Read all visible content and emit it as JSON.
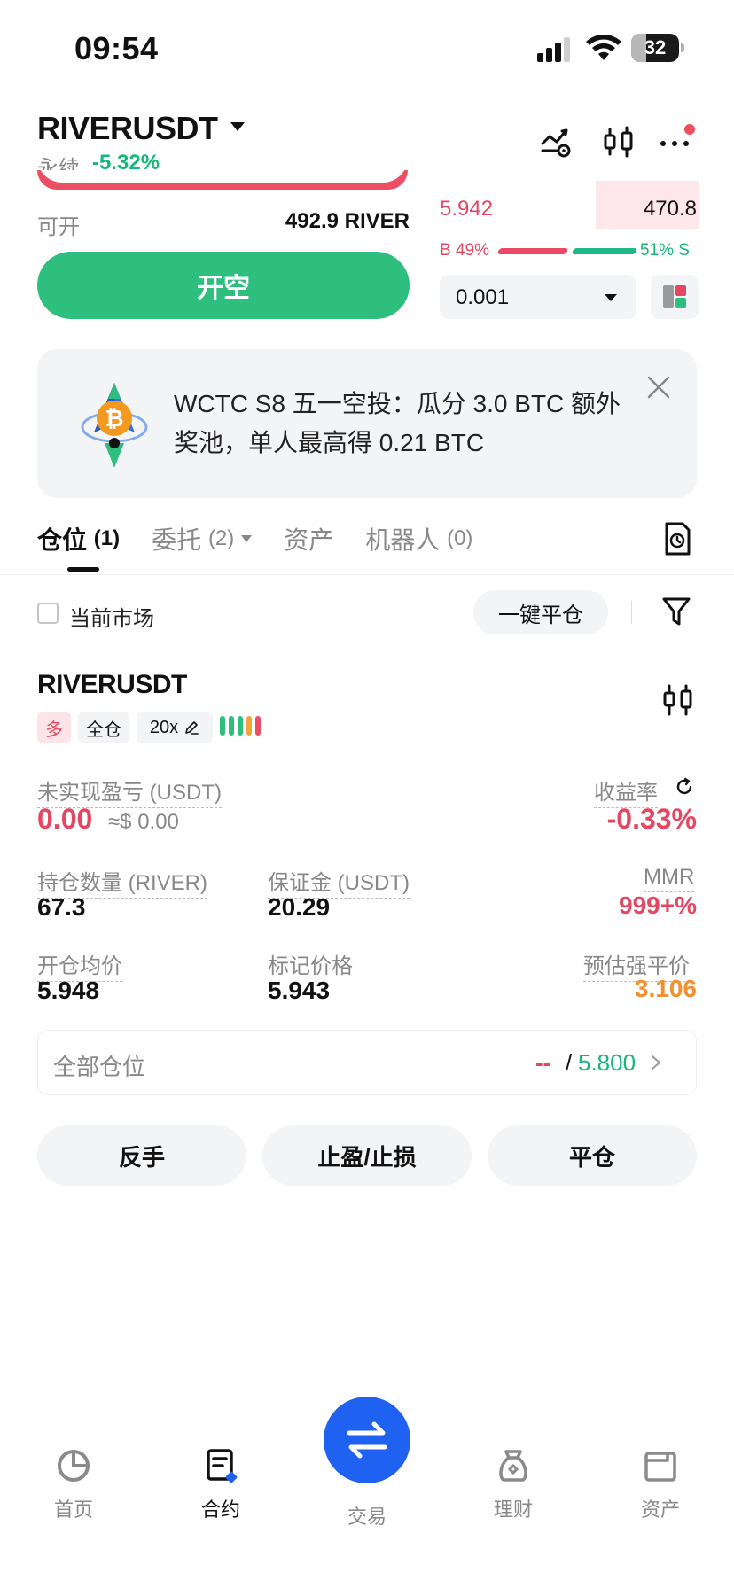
{
  "status_bar": {
    "time": "09:54",
    "battery": "32",
    "battery_level": 0.32
  },
  "header": {
    "pair": "RIVERUSDT",
    "contract_type": "永续",
    "change": "-5.32%",
    "icons": [
      "strategy-icon",
      "candlestick-icon",
      "more-icon"
    ]
  },
  "order_form": {
    "available_label": "可开",
    "available_value": "492.9 RIVER",
    "open_short_label": "开空"
  },
  "orderbook": {
    "price": "5.942",
    "quantity": "470.8",
    "buy_ratio": "B 49%",
    "sell_ratio": "51% S",
    "buy_ratio_value": 49,
    "sell_ratio_value": 51,
    "step": "0.001"
  },
  "promo": {
    "text": "WCTC S8 五一空投：瓜分 3.0 BTC 额外奖池，单人最高得 0.21 BTC"
  },
  "tabs": [
    {
      "label": "仓位",
      "count": "(1)"
    },
    {
      "label": "委托",
      "count": "(2)"
    },
    {
      "label": "资产",
      "count": ""
    },
    {
      "label": "机器人",
      "count": "(0)"
    }
  ],
  "filters": {
    "current_market": "当前市场",
    "close_all": "一键平仓"
  },
  "position": {
    "symbol": "RIVERUSDT",
    "side": "多",
    "margin_mode": "全仓",
    "leverage": "20x",
    "unrealized_pnl_label": "未实现盈亏 (USDT)",
    "unrealized_pnl": "0.00",
    "unrealized_pnl_usd": "≈$ 0.00",
    "roe_label": "收益率",
    "roe": "-0.33%",
    "size_label": "持仓数量 (RIVER)",
    "size": "67.3",
    "margin_label": "保证金 (USDT)",
    "margin": "20.29",
    "mmr_label": "MMR",
    "mmr": "999+%",
    "entry_label": "开仓均价",
    "entry": "5.948",
    "mark_label": "标记价格",
    "mark": "5.943",
    "liq_label": "预估强平价",
    "liq": "3.106"
  },
  "all_positions": {
    "label": "全部仓位",
    "dash": "--",
    "slash": "/",
    "value": "5.800"
  },
  "actions": {
    "reverse": "反手",
    "tp_sl": "止盈/止损",
    "close": "平仓"
  },
  "bottom_nav": [
    {
      "label": "首页",
      "icon": "home-icon"
    },
    {
      "label": "合约",
      "icon": "contract-icon"
    },
    {
      "label": "交易",
      "icon": "swap-icon"
    },
    {
      "label": "理财",
      "icon": "earn-icon"
    },
    {
      "label": "资产",
      "icon": "wallet-icon"
    }
  ],
  "colors": {
    "green": "#2ebf7f",
    "red": "#e54763",
    "orange": "#f0902e",
    "blue": "#1f61f0"
  }
}
